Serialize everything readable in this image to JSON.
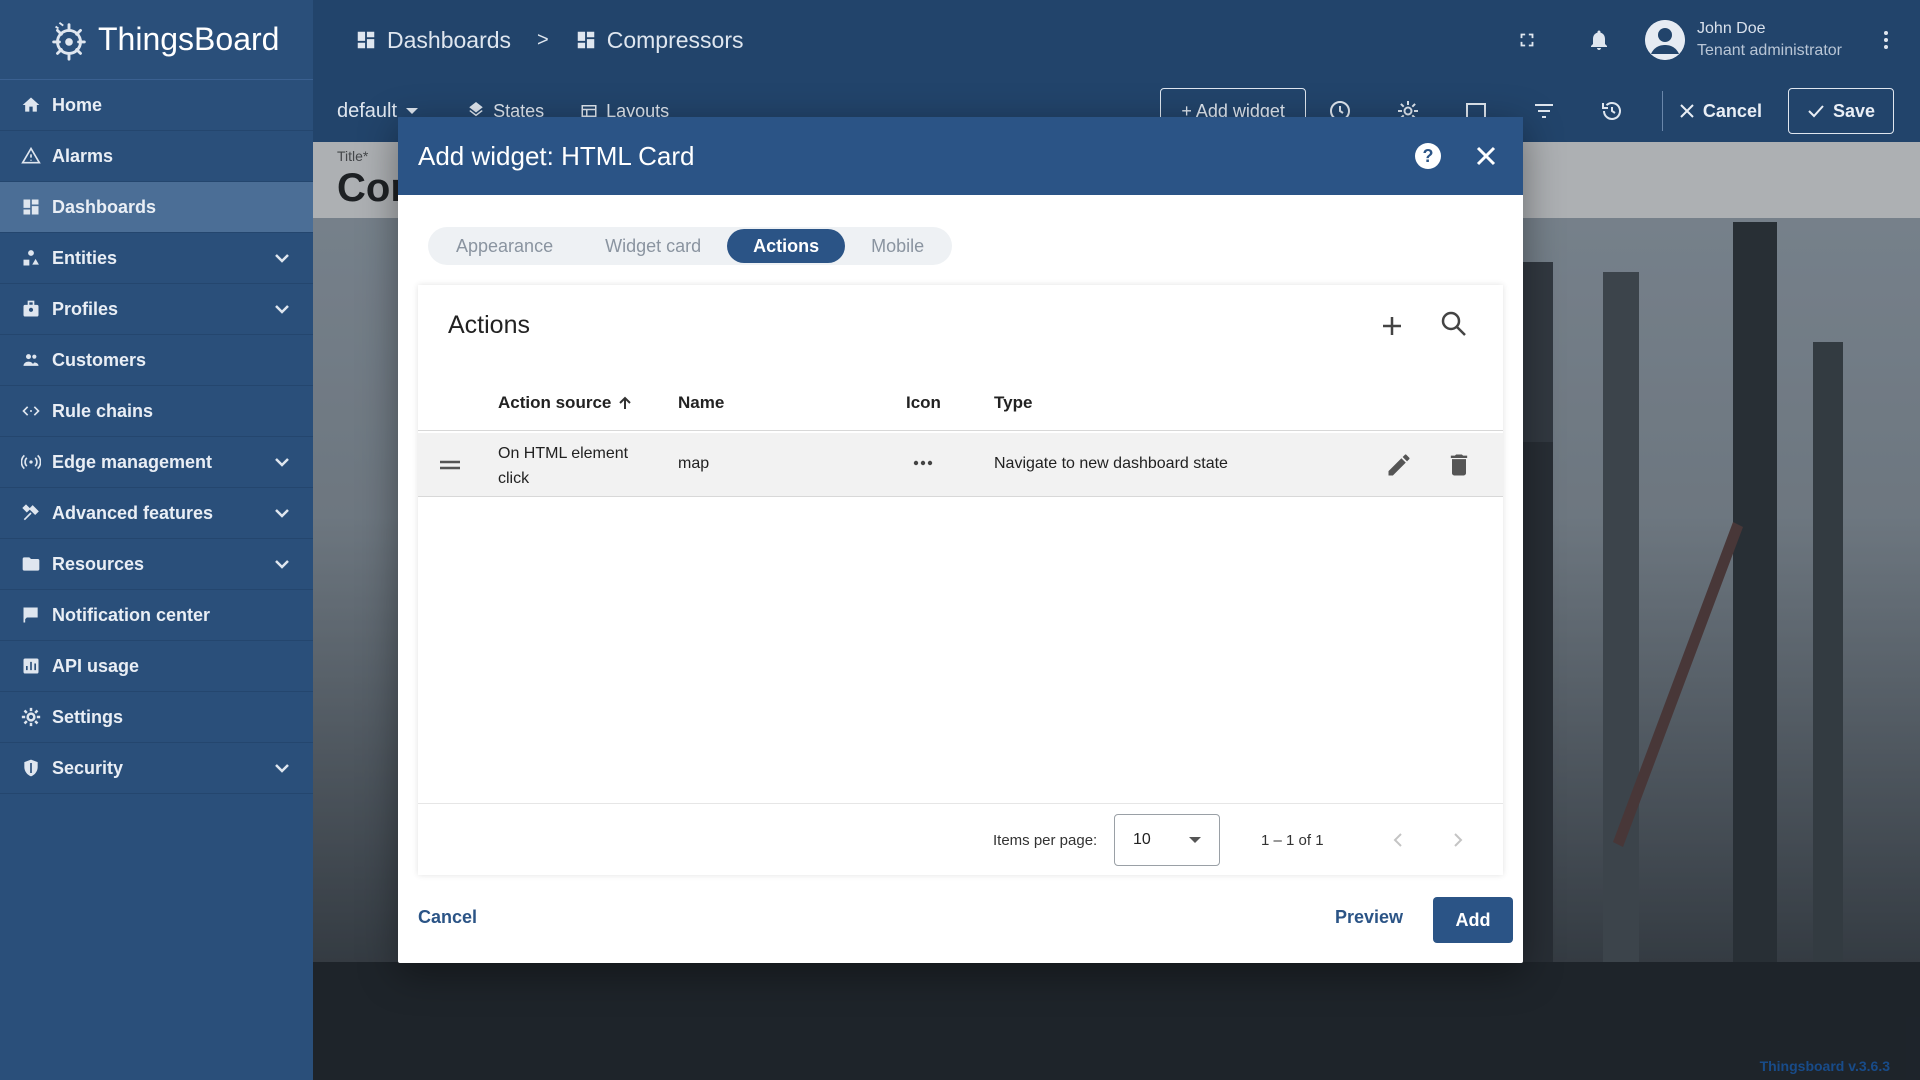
{
  "app": {
    "brand": "ThingsBoard",
    "version": "Thingsboard v.3.6.3"
  },
  "sidebar": {
    "items": [
      {
        "label": "Home",
        "icon": "home-icon",
        "expandable": false
      },
      {
        "label": "Alarms",
        "icon": "alarm-warning-icon",
        "expandable": false
      },
      {
        "label": "Dashboards",
        "icon": "dashboards-icon",
        "expandable": false,
        "active": true
      },
      {
        "label": "Entities",
        "icon": "entities-icon",
        "expandable": true
      },
      {
        "label": "Profiles",
        "icon": "profiles-icon",
        "expandable": true
      },
      {
        "label": "Customers",
        "icon": "customers-icon",
        "expandable": false
      },
      {
        "label": "Rule chains",
        "icon": "rule-chains-icon",
        "expandable": false
      },
      {
        "label": "Edge management",
        "icon": "edge-icon",
        "expandable": true
      },
      {
        "label": "Advanced features",
        "icon": "tools-icon",
        "expandable": true
      },
      {
        "label": "Resources",
        "icon": "folder-icon",
        "expandable": true
      },
      {
        "label": "Notification center",
        "icon": "notification-icon",
        "expandable": false
      },
      {
        "label": "API usage",
        "icon": "api-usage-icon",
        "expandable": false
      },
      {
        "label": "Settings",
        "icon": "gear-icon",
        "expandable": false
      },
      {
        "label": "Security",
        "icon": "shield-icon",
        "expandable": true
      }
    ]
  },
  "header": {
    "breadcrumb": [
      "Dashboards",
      "Compressors"
    ],
    "separator": ">",
    "user": {
      "name": "John Doe",
      "role": "Tenant administrator"
    }
  },
  "toolbar": {
    "state": "default",
    "states_label": "States",
    "layouts_label": "Layouts",
    "add_widget_label": "+ Add widget",
    "cancel_label": "Cancel",
    "save_label": "Save"
  },
  "dashboard": {
    "title_label": "Title*",
    "title_value": "Cor"
  },
  "dialog": {
    "title_prefix": "Add widget:",
    "title_widget": "HTML Card",
    "tabs": [
      {
        "label": "Appearance",
        "active": false
      },
      {
        "label": "Widget card",
        "active": false
      },
      {
        "label": "Actions",
        "active": true
      },
      {
        "label": "Mobile",
        "active": false
      }
    ],
    "panel_title": "Actions",
    "columns": {
      "source": "Action source",
      "name": "Name",
      "icon": "Icon",
      "type": "Type"
    },
    "rows": [
      {
        "source": "On HTML element click",
        "name": "map",
        "icon": "more-horiz-icon",
        "type": "Navigate to new dashboard state"
      }
    ],
    "paginator": {
      "items_per_page_label": "Items per page:",
      "items_per_page": "10",
      "range": "1 – 1 of 1"
    },
    "footer": {
      "cancel": "Cancel",
      "preview": "Preview",
      "add": "Add"
    }
  },
  "colors": {
    "primary": "#2b5486",
    "sidebar": "#2a4f7a",
    "topbar": "#22446b"
  }
}
